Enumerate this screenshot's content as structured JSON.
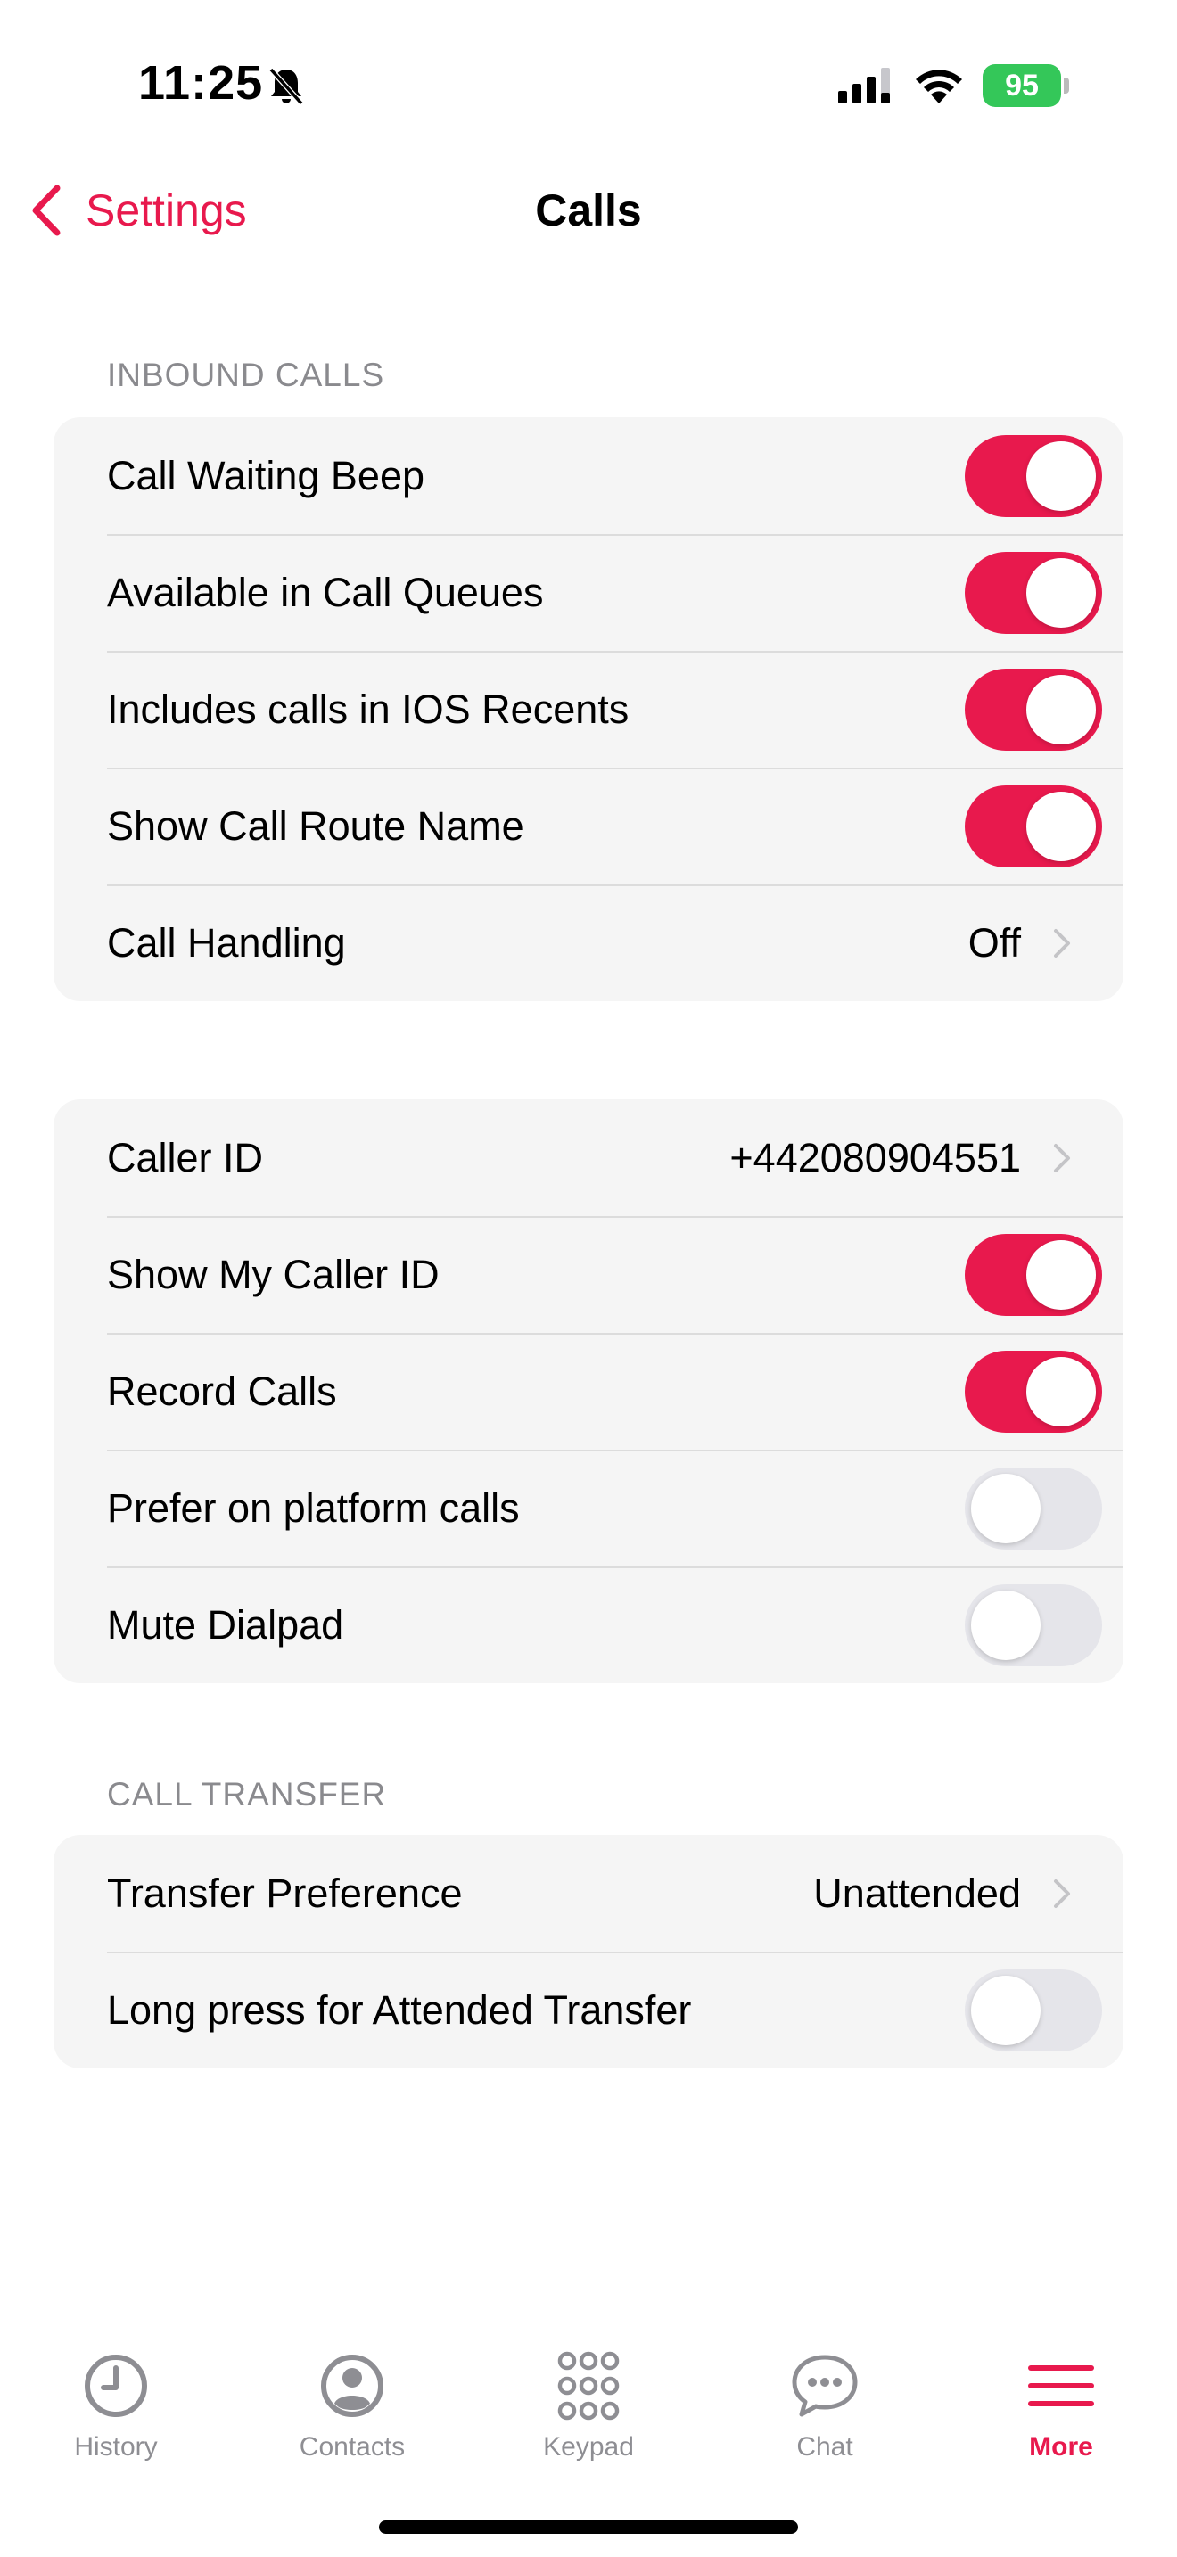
{
  "status_bar": {
    "time": "11:25",
    "battery": "95"
  },
  "nav": {
    "back_label": "Settings",
    "title": "Calls"
  },
  "sections": {
    "inbound_header": "INBOUND CALLS",
    "transfer_header": "CALL TRANSFER"
  },
  "inbound": {
    "call_waiting_beep": {
      "label": "Call Waiting Beep",
      "on": true
    },
    "available_in_queues": {
      "label": "Available in Call Queues",
      "on": true
    },
    "ios_recents": {
      "label": "Includes calls in IOS Recents",
      "on": true
    },
    "show_route_name": {
      "label": "Show Call Route Name",
      "on": true
    },
    "call_handling": {
      "label": "Call Handling",
      "value": "Off"
    }
  },
  "outbound": {
    "caller_id": {
      "label": "Caller ID",
      "value": "+442080904551"
    },
    "show_caller_id": {
      "label": "Show My Caller ID",
      "on": true
    },
    "record_calls": {
      "label": "Record Calls",
      "on": true
    },
    "prefer_platform": {
      "label": "Prefer on platform calls",
      "on": false
    },
    "mute_dialpad": {
      "label": "Mute Dialpad",
      "on": false
    }
  },
  "transfer": {
    "preference": {
      "label": "Transfer Preference",
      "value": "Unattended"
    },
    "long_press": {
      "label": "Long press for Attended Transfer",
      "on": false
    }
  },
  "tabs": [
    {
      "label": "History",
      "icon": "clock-icon",
      "active": false
    },
    {
      "label": "Contacts",
      "icon": "person-icon",
      "active": false
    },
    {
      "label": "Keypad",
      "icon": "keypad-icon",
      "active": false
    },
    {
      "label": "Chat",
      "icon": "chat-bubble-icon",
      "active": false
    },
    {
      "label": "More",
      "icon": "hamburger-menu-icon",
      "active": true
    }
  ],
  "colors": {
    "accent": "#e8194d",
    "toggle_off": "#e5e5ea",
    "battery": "#34c759",
    "group_bg": "#f5f5f5"
  }
}
